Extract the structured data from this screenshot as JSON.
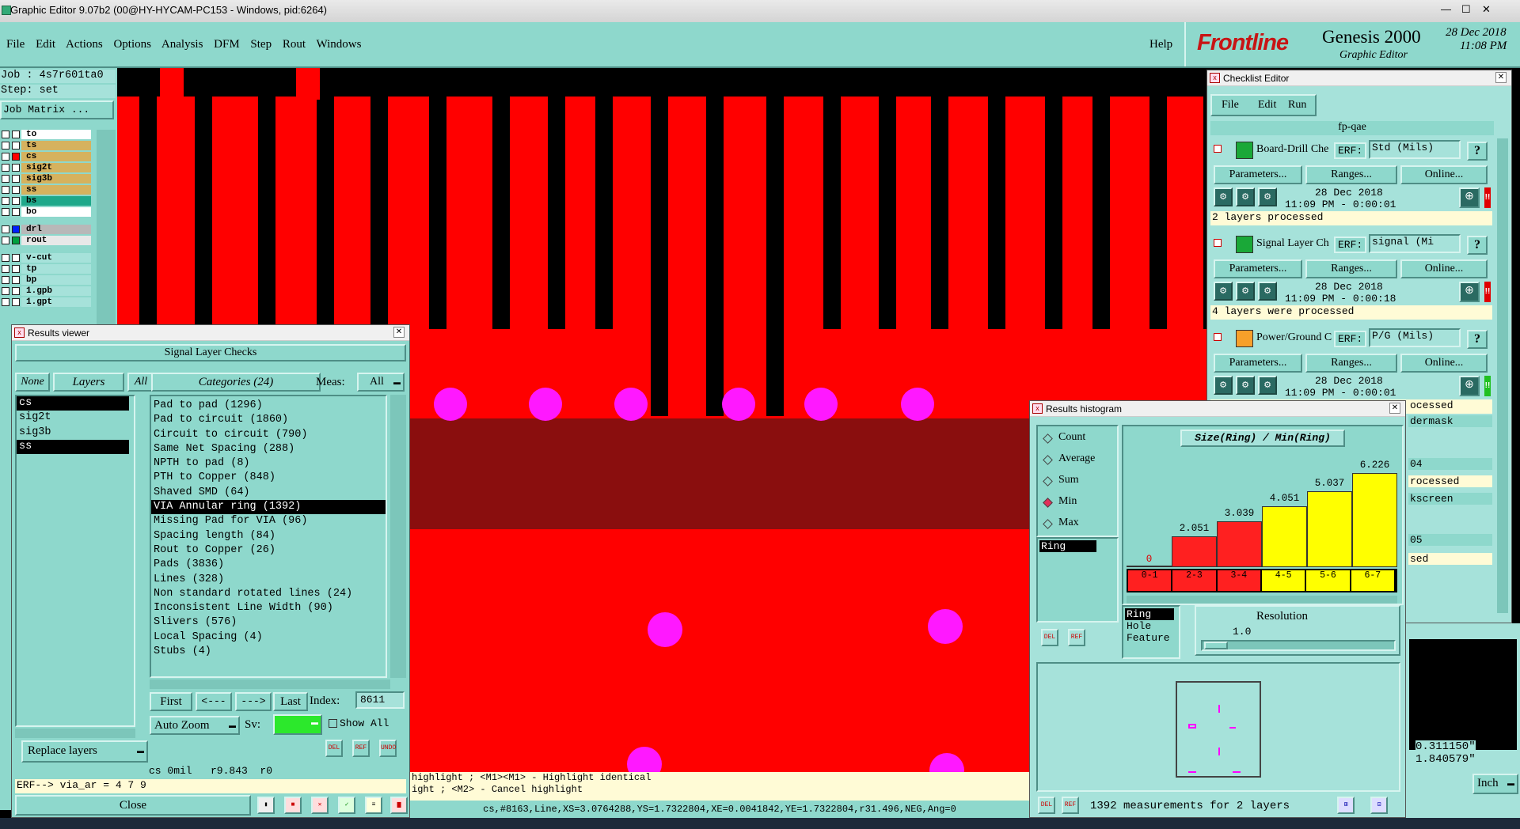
{
  "window": {
    "title": "Graphic Editor 9.07b2 (00@HY-HYCAM-PC153 - Windows, pid:6264)",
    "controls": [
      "—",
      "☐",
      "✕"
    ]
  },
  "menubar": {
    "items": [
      "File",
      "Edit",
      "Actions",
      "Options",
      "Analysis",
      "DFM",
      "Step",
      "Rout",
      "Windows"
    ],
    "help": "Help"
  },
  "brand": {
    "logo": "Frontline",
    "product": "Genesis 2000",
    "subtitle": "Graphic Editor",
    "date": "28 Dec 2018",
    "time": "11:08 PM"
  },
  "job": {
    "job_line": "Job : 4s7r601ta0",
    "step_line": "Step: set",
    "matrix_button": "Job Matrix ..."
  },
  "layers": [
    {
      "name": "to",
      "color": "#ffffff"
    },
    {
      "name": "ts",
      "color": "#d6b25e"
    },
    {
      "name": "cs",
      "color": "#d6b25e"
    },
    {
      "name": "sig2t",
      "color": "#d6b25e"
    },
    {
      "name": "sig3b",
      "color": "#d6b25e"
    },
    {
      "name": "ss",
      "color": "#d6b25e"
    },
    {
      "name": "bs",
      "color": "#1fa88a"
    },
    {
      "name": "bo",
      "color": "#ffffff"
    },
    {
      "name": "drl",
      "color": "#b8b8b8"
    },
    {
      "name": "rout",
      "color": "#e8e8e8"
    },
    {
      "name": "v-cut",
      "color": "#a6e2da"
    },
    {
      "name": "tp",
      "color": "#a6e2da"
    },
    {
      "name": "bp",
      "color": "#a6e2da"
    },
    {
      "name": "1.gpb",
      "color": "#a6e2da"
    },
    {
      "name": "1.gpt",
      "color": "#a6e2da"
    }
  ],
  "results_viewer": {
    "title": "Results viewer",
    "header": "Signal Layer Checks",
    "none_button": "None",
    "layers_label": "Layers",
    "all_button": "All",
    "categories_label": "Categories (24)",
    "meas_label": "Meas:",
    "meas_value": "All",
    "layer_list": [
      "cs",
      "sig2t",
      "sig3b",
      "ss"
    ],
    "categories": [
      "Pad to pad (1296)",
      "Pad to circuit (1860)",
      "Circuit to circuit (790)",
      "Same Net Spacing (288)",
      "NPTH to pad (8)",
      "PTH to Copper (848)",
      "Shaved SMD (64)",
      "VIA Annular ring (1392)",
      "Missing Pad for VIA (96)",
      "Spacing length (84)",
      "Rout to Copper (26)",
      "Pads (3836)",
      "Lines (328)",
      "Non standard rotated lines (24)",
      "Inconsistent Line Width (90)",
      "Slivers (576)",
      "Local Spacing (4)",
      "Stubs (4)"
    ],
    "selected_category": "VIA Annular ring (1392)",
    "nav": {
      "first": "First",
      "prev": "<---",
      "next": "--->",
      "last": "Last",
      "index_label": "Index:",
      "index_value": "8611"
    },
    "zoom": "Auto Zoom",
    "sv_label": "Sv:",
    "show_all": "Show All",
    "small_buttons": [
      "DEL",
      "REF",
      "UNDO"
    ],
    "replace_layers": "Replace layers",
    "status_line": "cs 0mil   r9.843  r0",
    "erf_line": "ERF--> via_ar = 4 7 9",
    "close": "Close"
  },
  "messages": {
    "line1": "highlight ; <M1><M1> - Highlight identical",
    "line2": "ight ; <M2> - Cancel highlight",
    "status": "cs,#8163,Line,XS=3.0764288,YS=1.7322804,XE=0.0041842,YE=1.7322804,r31.496,NEG,Ang=0"
  },
  "checklist": {
    "title": "Checklist Editor",
    "menu": [
      "File",
      "Edit",
      "Run"
    ],
    "name": "fp-qae",
    "rows": [
      {
        "title": "Board-Drill Che",
        "erf": "ERF:",
        "param": "Std (Mils)",
        "date": "28 Dec 2018",
        "time": "11:09 PM - 0:00:01",
        "status": "2 layers processed",
        "flag": "#e00000"
      },
      {
        "title": "Signal Layer Ch",
        "erf": "ERF:",
        "param": "signal (Mi",
        "date": "28 Dec 2018",
        "time": "11:09 PM - 0:00:18",
        "status": "4 layers were processed",
        "flag": "#e00000"
      },
      {
        "title": "Power/Ground C",
        "erf": "ERF:",
        "param": "P/G (Mils)",
        "date": "28 Dec 2018",
        "time": "11:09 PM - 0:00:01",
        "status": "ocessed",
        "flag": "#20c020"
      }
    ],
    "buttons": {
      "params": "Parameters...",
      "ranges": "Ranges...",
      "online": "Online..."
    },
    "partial": {
      "r4_status": "ocessed",
      "r4_title": "dermask",
      "r5_title": "04",
      "r5_status": "rocessed",
      "r6_title": "kscreen",
      "r6_status": "05",
      "r7_status": "sed"
    },
    "help_glyph": "?"
  },
  "histogram": {
    "title": "Results histogram",
    "chart_title": "Size(Ring) / Min(Ring)",
    "radio_options": [
      "Count",
      "Average",
      "Sum",
      "Min",
      "Max"
    ],
    "selected_radio": "Min",
    "list_item": "Ring",
    "filter_options": [
      "Ring",
      "Hole",
      "Feature"
    ],
    "resolution_label": "Resolution",
    "resolution_value": "1.0",
    "footer": "1392 measurements for 2 layers",
    "small_buttons": [
      "DEL",
      "REF"
    ]
  },
  "chart_data": {
    "type": "bar",
    "title": "Size(Ring) / Min(Ring)",
    "categories": [
      "0-1",
      "2-3",
      "3-4",
      "4-5",
      "5-6",
      "6-7"
    ],
    "values": [
      0,
      2.051,
      3.039,
      4.051,
      5.037,
      6.226
    ],
    "value_labels": [
      "0",
      "2.051",
      "3.039",
      "4.051",
      "5.037",
      "6.226"
    ],
    "colors": [
      "#ff2020",
      "#ff2020",
      "#ff2020",
      "#ffff00",
      "#ffff00",
      "#ffff00"
    ],
    "ylim": [
      0,
      6.5
    ]
  },
  "coords": {
    "x": "0.311150\"",
    "y": "1.840579\"",
    "unit": "Inch"
  }
}
